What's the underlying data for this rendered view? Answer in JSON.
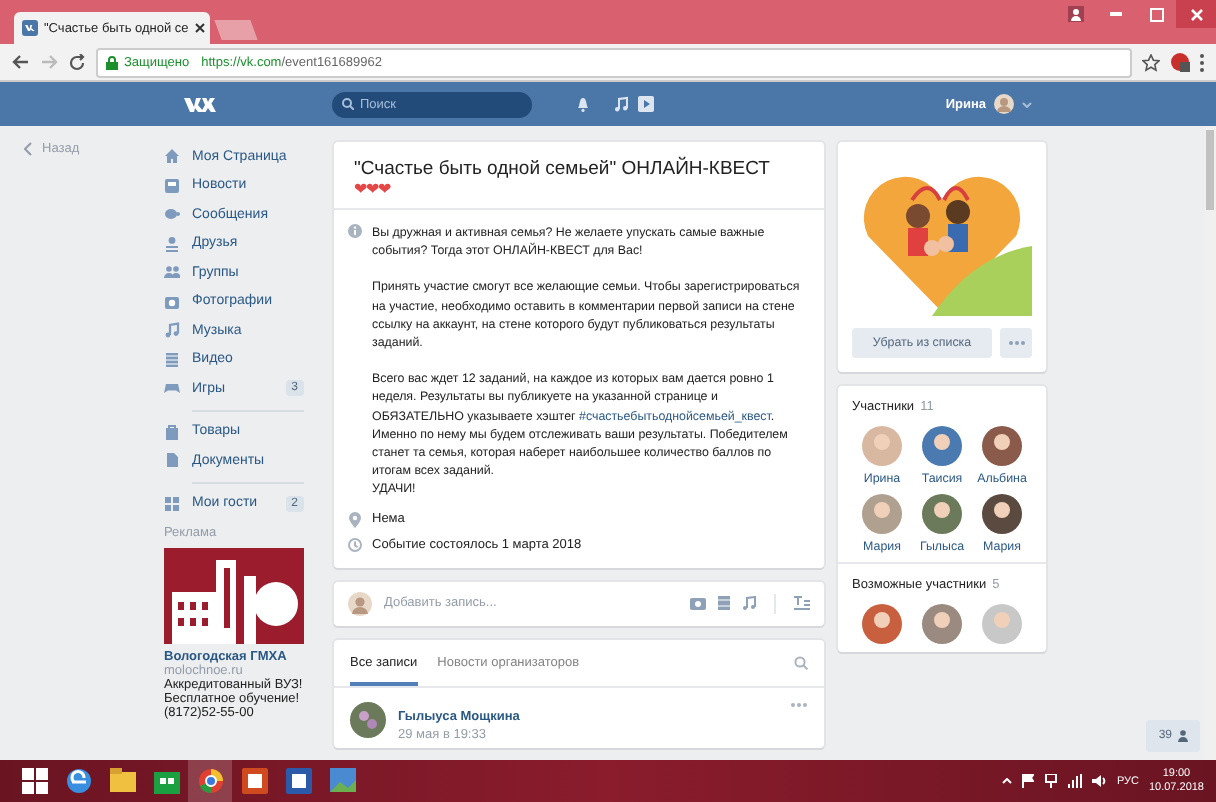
{
  "browser": {
    "tab_title": "\"Счастье быть одной се",
    "security": "Защищено",
    "url_host": "https://vk.com",
    "url_path": "/event161689962"
  },
  "header": {
    "search_placeholder": "Поиск",
    "user_name": "Ирина"
  },
  "back_link": "Назад",
  "nav": {
    "groups": [
      [
        {
          "label": "Моя Страница"
        },
        {
          "label": "Новости"
        },
        {
          "label": "Сообщения"
        },
        {
          "label": "Друзья"
        },
        {
          "label": "Группы"
        },
        {
          "label": "Фотографии"
        },
        {
          "label": "Музыка"
        },
        {
          "label": "Видео"
        },
        {
          "label": "Игры",
          "badge": "3"
        }
      ],
      [
        {
          "label": "Товары"
        },
        {
          "label": "Документы"
        }
      ],
      [
        {
          "label": "Мои гости",
          "badge": "2"
        }
      ]
    ]
  },
  "ad": {
    "heading": "Реклама",
    "title": "Вологодская ГМХА",
    "domain": "molochnoe.ru",
    "lines": [
      "Аккредитованный ВУЗ!",
      "Бесплатное обучение!",
      "(8172)52-55-00"
    ]
  },
  "event": {
    "title": "\"Счастье быть одной семьей\" ОНЛАЙН-КВЕСТ",
    "hearts": "❤❤❤",
    "paragraphs": [
      {
        "parts": [
          {
            "text": "Вы дружная и активная семья? Не желаете упускать самые важные события? Тогда этот ОНЛАЙН-КВЕСТ для Вас!"
          }
        ]
      },
      {
        "parts": [
          {
            "text": "Принять участие смогут все желающие семьи. Чтобы зарегистрироваться на участие, необходимо оставить в комментарии первой записи на стене ссылку на аккаунт, на стене которого будут публиковаться результаты заданий."
          }
        ]
      },
      {
        "parts": [
          {
            "text": "Всего вас ждет 12 заданий, на каждое из которых вам дается ровно 1 неделя. Результаты вы публикуете на указанной странице и ОБЯЗАТЕЛЬНО указываете хэштег "
          },
          {
            "text": "#счастьебытьоднойсемьей_квест",
            "kind": "hashtag"
          },
          {
            "text": ". Именно по нему мы будем отслеживать ваши результаты. Победителем станет та семья, которая наберет наибольшее количество баллов по итогам всех заданий."
          }
        ]
      }
    ],
    "closing": "УДАЧИ!",
    "location": "Нема",
    "date": "Событие состоялось 1 марта 2018"
  },
  "compose": {
    "placeholder": "Добавить запись..."
  },
  "wall": {
    "tabs": [
      {
        "label": "Все записи",
        "selected": true
      },
      {
        "label": "Новости организаторов",
        "selected": false
      }
    ],
    "post": {
      "author": "Гылыуса Мощкина",
      "time": "29 мая в 19:33"
    }
  },
  "side": {
    "action_button": "Убрать из списка",
    "members": {
      "heading": "Участники",
      "count": "11",
      "people": [
        "Ирина",
        "Таисия",
        "Альбина",
        "Мария",
        "Гылыса",
        "Мария"
      ]
    },
    "possible": {
      "heading": "Возможные участники",
      "count": "5"
    }
  },
  "friends_badge": "39",
  "taskbar": {
    "language": "РУС",
    "time": "19:00",
    "date": "10.07.2018"
  }
}
